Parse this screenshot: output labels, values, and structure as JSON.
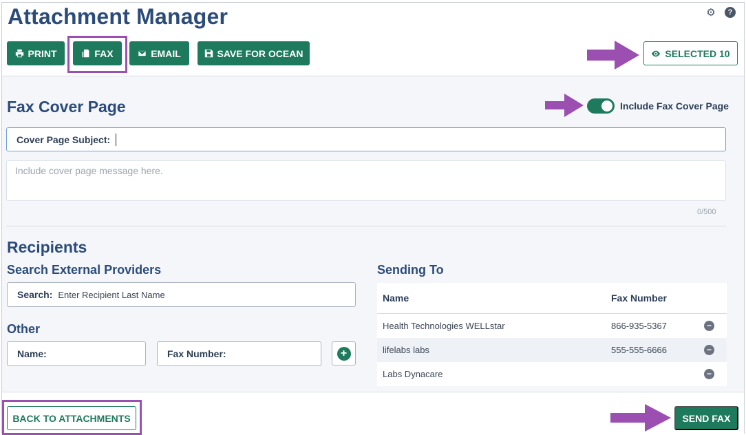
{
  "header": {
    "title": "Attachment Manager",
    "toolbar": {
      "print_label": "PRINT",
      "fax_label": "FAX",
      "email_label": "EMAIL",
      "save_ocean_label": "SAVE FOR OCEAN"
    },
    "selected_label": "SELECTED 10",
    "help_glyph": "?"
  },
  "fax_cover": {
    "heading": "Fax Cover Page",
    "toggle_label": "Include Fax Cover Page",
    "toggle_on": true,
    "subject_label": "Cover Page Subject:",
    "subject_value": "",
    "message_placeholder": "Include cover page message here.",
    "char_counter": "0/500"
  },
  "recipients": {
    "heading": "Recipients",
    "search": {
      "heading": "Search External Providers",
      "label": "Search:",
      "placeholder": "Enter Recipient Last Name"
    },
    "other": {
      "heading": "Other",
      "name_label": "Name:",
      "fax_label": "Fax Number:"
    },
    "sending_to": {
      "heading": "Sending To",
      "columns": [
        "Name",
        "Fax Number"
      ],
      "rows": [
        {
          "name": "Health Technologies WELLstar",
          "fax": "866-935-5367"
        },
        {
          "name": "lifelabs labs",
          "fax": "555-555-6666"
        },
        {
          "name": "Labs Dynacare",
          "fax": ""
        }
      ]
    }
  },
  "footer": {
    "back_label": "BACK TO ATTACHMENTS",
    "send_label": "SEND FAX"
  },
  "colors": {
    "primary_green": "#1e7a5c",
    "title_blue": "#2b4b7a",
    "annotation_purple": "#9b4fb0"
  }
}
